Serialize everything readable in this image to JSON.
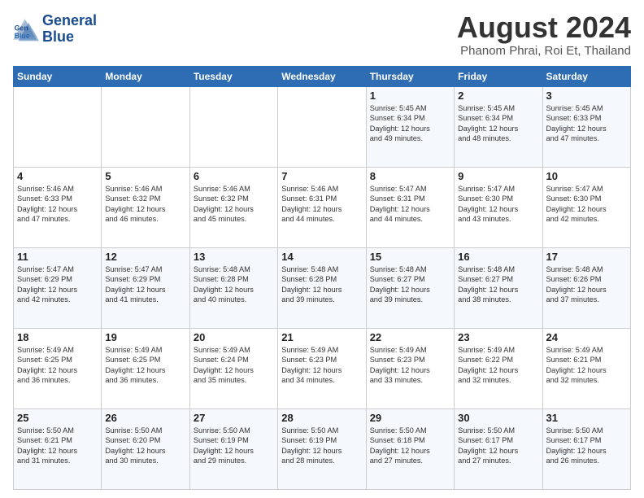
{
  "logo": {
    "line1": "General",
    "line2": "Blue"
  },
  "header": {
    "month": "August 2024",
    "location": "Phanom Phrai, Roi Et, Thailand"
  },
  "weekdays": [
    "Sunday",
    "Monday",
    "Tuesday",
    "Wednesday",
    "Thursday",
    "Friday",
    "Saturday"
  ],
  "weeks": [
    [
      {
        "day": "",
        "info": ""
      },
      {
        "day": "",
        "info": ""
      },
      {
        "day": "",
        "info": ""
      },
      {
        "day": "",
        "info": ""
      },
      {
        "day": "1",
        "info": "Sunrise: 5:45 AM\nSunset: 6:34 PM\nDaylight: 12 hours\nand 49 minutes."
      },
      {
        "day": "2",
        "info": "Sunrise: 5:45 AM\nSunset: 6:34 PM\nDaylight: 12 hours\nand 48 minutes."
      },
      {
        "day": "3",
        "info": "Sunrise: 5:45 AM\nSunset: 6:33 PM\nDaylight: 12 hours\nand 47 minutes."
      }
    ],
    [
      {
        "day": "4",
        "info": "Sunrise: 5:46 AM\nSunset: 6:33 PM\nDaylight: 12 hours\nand 47 minutes."
      },
      {
        "day": "5",
        "info": "Sunrise: 5:46 AM\nSunset: 6:32 PM\nDaylight: 12 hours\nand 46 minutes."
      },
      {
        "day": "6",
        "info": "Sunrise: 5:46 AM\nSunset: 6:32 PM\nDaylight: 12 hours\nand 45 minutes."
      },
      {
        "day": "7",
        "info": "Sunrise: 5:46 AM\nSunset: 6:31 PM\nDaylight: 12 hours\nand 44 minutes."
      },
      {
        "day": "8",
        "info": "Sunrise: 5:47 AM\nSunset: 6:31 PM\nDaylight: 12 hours\nand 44 minutes."
      },
      {
        "day": "9",
        "info": "Sunrise: 5:47 AM\nSunset: 6:30 PM\nDaylight: 12 hours\nand 43 minutes."
      },
      {
        "day": "10",
        "info": "Sunrise: 5:47 AM\nSunset: 6:30 PM\nDaylight: 12 hours\nand 42 minutes."
      }
    ],
    [
      {
        "day": "11",
        "info": "Sunrise: 5:47 AM\nSunset: 6:29 PM\nDaylight: 12 hours\nand 42 minutes."
      },
      {
        "day": "12",
        "info": "Sunrise: 5:47 AM\nSunset: 6:29 PM\nDaylight: 12 hours\nand 41 minutes."
      },
      {
        "day": "13",
        "info": "Sunrise: 5:48 AM\nSunset: 6:28 PM\nDaylight: 12 hours\nand 40 minutes."
      },
      {
        "day": "14",
        "info": "Sunrise: 5:48 AM\nSunset: 6:28 PM\nDaylight: 12 hours\nand 39 minutes."
      },
      {
        "day": "15",
        "info": "Sunrise: 5:48 AM\nSunset: 6:27 PM\nDaylight: 12 hours\nand 39 minutes."
      },
      {
        "day": "16",
        "info": "Sunrise: 5:48 AM\nSunset: 6:27 PM\nDaylight: 12 hours\nand 38 minutes."
      },
      {
        "day": "17",
        "info": "Sunrise: 5:48 AM\nSunset: 6:26 PM\nDaylight: 12 hours\nand 37 minutes."
      }
    ],
    [
      {
        "day": "18",
        "info": "Sunrise: 5:49 AM\nSunset: 6:25 PM\nDaylight: 12 hours\nand 36 minutes."
      },
      {
        "day": "19",
        "info": "Sunrise: 5:49 AM\nSunset: 6:25 PM\nDaylight: 12 hours\nand 36 minutes."
      },
      {
        "day": "20",
        "info": "Sunrise: 5:49 AM\nSunset: 6:24 PM\nDaylight: 12 hours\nand 35 minutes."
      },
      {
        "day": "21",
        "info": "Sunrise: 5:49 AM\nSunset: 6:23 PM\nDaylight: 12 hours\nand 34 minutes."
      },
      {
        "day": "22",
        "info": "Sunrise: 5:49 AM\nSunset: 6:23 PM\nDaylight: 12 hours\nand 33 minutes."
      },
      {
        "day": "23",
        "info": "Sunrise: 5:49 AM\nSunset: 6:22 PM\nDaylight: 12 hours\nand 32 minutes."
      },
      {
        "day": "24",
        "info": "Sunrise: 5:49 AM\nSunset: 6:21 PM\nDaylight: 12 hours\nand 32 minutes."
      }
    ],
    [
      {
        "day": "25",
        "info": "Sunrise: 5:50 AM\nSunset: 6:21 PM\nDaylight: 12 hours\nand 31 minutes."
      },
      {
        "day": "26",
        "info": "Sunrise: 5:50 AM\nSunset: 6:20 PM\nDaylight: 12 hours\nand 30 minutes."
      },
      {
        "day": "27",
        "info": "Sunrise: 5:50 AM\nSunset: 6:19 PM\nDaylight: 12 hours\nand 29 minutes."
      },
      {
        "day": "28",
        "info": "Sunrise: 5:50 AM\nSunset: 6:19 PM\nDaylight: 12 hours\nand 28 minutes."
      },
      {
        "day": "29",
        "info": "Sunrise: 5:50 AM\nSunset: 6:18 PM\nDaylight: 12 hours\nand 27 minutes."
      },
      {
        "day": "30",
        "info": "Sunrise: 5:50 AM\nSunset: 6:17 PM\nDaylight: 12 hours\nand 27 minutes."
      },
      {
        "day": "31",
        "info": "Sunrise: 5:50 AM\nSunset: 6:17 PM\nDaylight: 12 hours\nand 26 minutes."
      }
    ]
  ]
}
